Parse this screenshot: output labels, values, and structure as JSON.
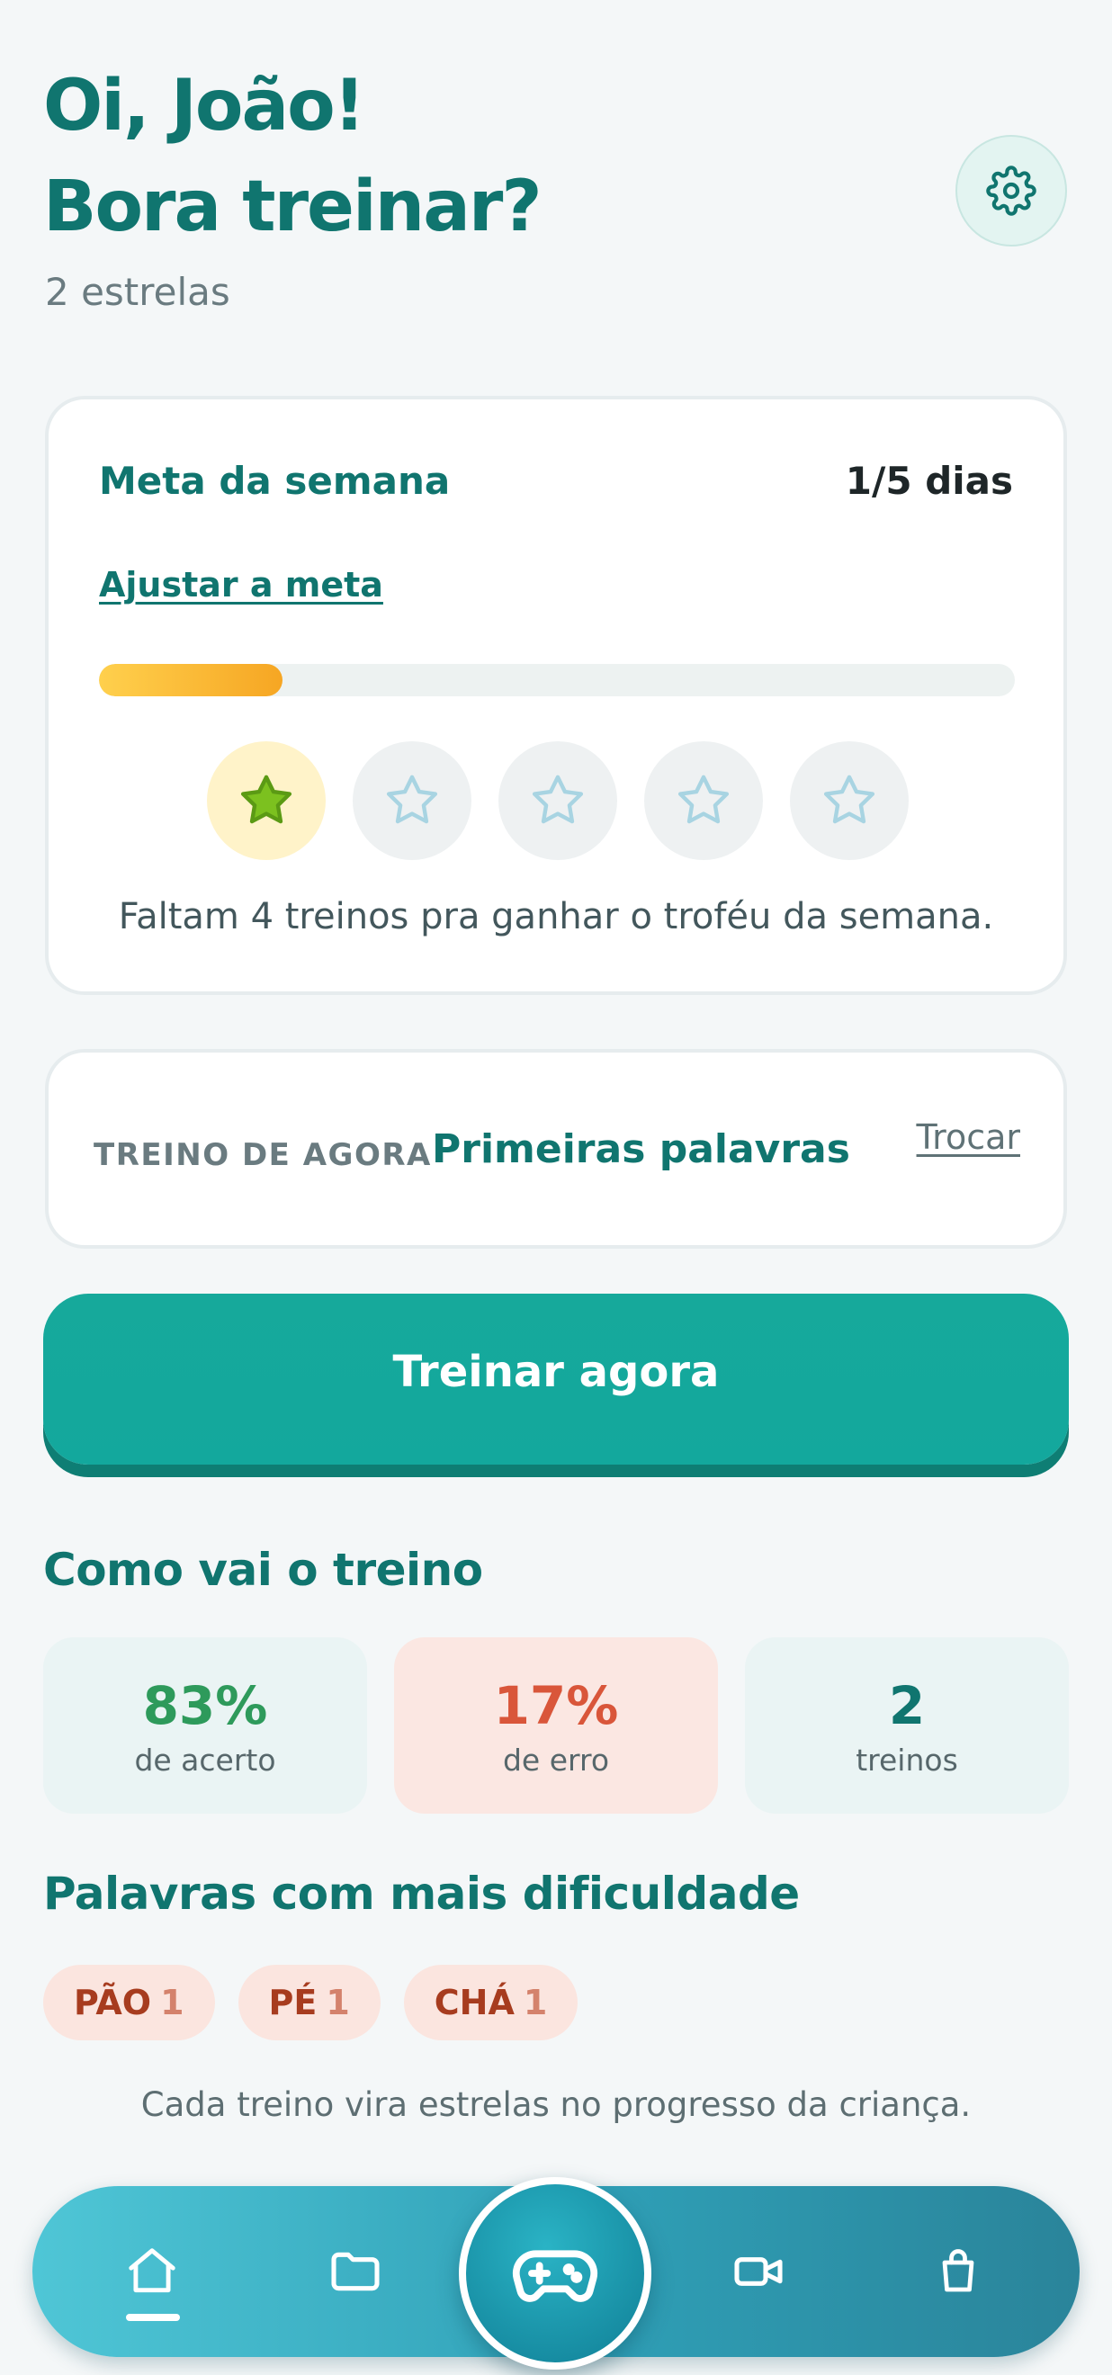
{
  "header": {
    "greeting_line1": "Oi, João!",
    "greeting_line2": "Bora treinar?",
    "stars": "2 estrelas"
  },
  "weekly_goal": {
    "title": "Meta da semana",
    "days": "1/5 dias",
    "adjust_link": "Ajustar a meta",
    "progress_fraction": 0.2,
    "stars_earned": 1,
    "stars_total": 5,
    "note": "Faltam 4 treinos pra ganhar o troféu da semana."
  },
  "current_training": {
    "label": "TREINO DE AGORA",
    "name": "Primeiras palavras",
    "change_link": "Trocar"
  },
  "cta": {
    "label": "Treinar agora"
  },
  "progress_section": {
    "title": "Como vai o treino",
    "stats": [
      {
        "value": "83%",
        "label": "de acerto",
        "color": "#2e9a5b"
      },
      {
        "value": "17%",
        "label": "de erro",
        "color": "#d9563a"
      },
      {
        "value": "2",
        "label": "treinos",
        "color": "#10756f"
      }
    ]
  },
  "difficult_words": {
    "title": "Palavras com mais dificuldade",
    "chips": [
      {
        "word": "PÃO",
        "count": "1"
      },
      {
        "word": "PÉ",
        "count": "1"
      },
      {
        "word": "CHÁ",
        "count": "1"
      }
    ]
  },
  "footer_note": "Cada treino vira estrelas no progresso da criança.",
  "bottom_nav": {
    "items": [
      {
        "icon": "home-icon",
        "active": true
      },
      {
        "icon": "folder-icon",
        "active": false
      },
      {
        "icon": "gamepad-icon",
        "active": false
      },
      {
        "icon": "video-icon",
        "active": false
      },
      {
        "icon": "shopping-bag-icon",
        "active": false
      }
    ]
  },
  "colors": {
    "brand": "#10756f",
    "cta": "#13a89d",
    "star_filled": "#7cc11f",
    "star_empty": "#a8d4e2"
  }
}
